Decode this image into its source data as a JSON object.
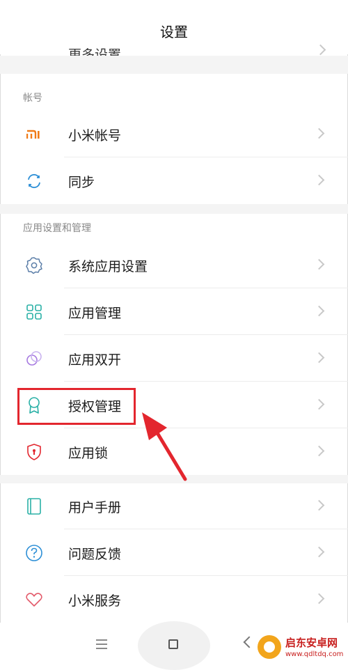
{
  "header": {
    "title": "设置"
  },
  "top_cut": {
    "label": "更多设置"
  },
  "sections": [
    {
      "label": "帐号",
      "items": [
        {
          "label": "小米帐号",
          "icon": "mi-logo-icon"
        },
        {
          "label": "同步",
          "icon": "sync-icon"
        }
      ]
    },
    {
      "label": "应用设置和管理",
      "items": [
        {
          "label": "系统应用设置",
          "icon": "gear-icon"
        },
        {
          "label": "应用管理",
          "icon": "grid-icon"
        },
        {
          "label": "应用双开",
          "icon": "dual-app-icon"
        },
        {
          "label": "授权管理",
          "icon": "badge-icon"
        },
        {
          "label": "应用锁",
          "icon": "shield-lock-icon"
        }
      ]
    },
    {
      "label": "",
      "items": [
        {
          "label": "用户手册",
          "icon": "book-icon"
        },
        {
          "label": "问题反馈",
          "icon": "question-icon"
        },
        {
          "label": "小米服务",
          "icon": "heart-icon"
        }
      ]
    }
  ],
  "colors": {
    "mi_orange": "#f07a16",
    "teal": "#2ab0a6",
    "blue": "#2d8fd6",
    "red": "#e3262e",
    "purple": "#a679e0"
  },
  "watermark": {
    "title": "启东安卓网",
    "url": "www.qdltdq.com"
  }
}
